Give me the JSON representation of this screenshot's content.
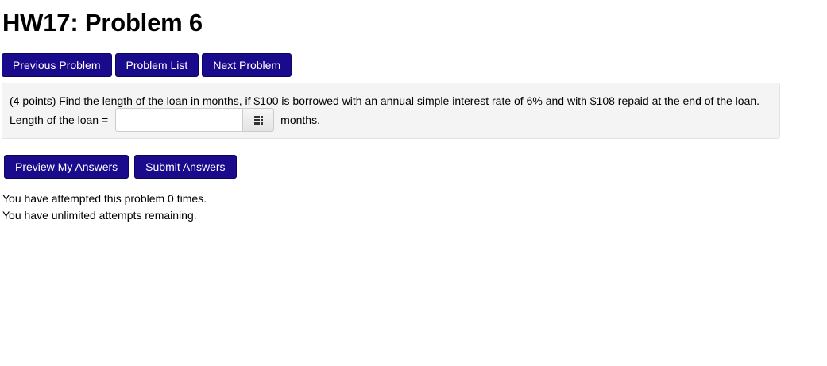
{
  "page": {
    "title": "HW17: Problem 6"
  },
  "nav": {
    "previous_label": "Previous Problem",
    "list_label": "Problem List",
    "next_label": "Next Problem"
  },
  "problem": {
    "text": "(4 points) Find the length of the loan in months, if $100 is borrowed with an annual simple interest rate of 6% and with $108 repaid at the end of the loan.",
    "answer_label": "Length of the loan =",
    "answer_value": "",
    "answer_placeholder": "",
    "answer_suffix": "months.",
    "palette_icon": "grid-icon"
  },
  "actions": {
    "preview_label": "Preview My Answers",
    "submit_label": "Submit Answers"
  },
  "status": {
    "attempts_line": "You have attempted this problem 0 times.",
    "remaining_line": "You have unlimited attempts remaining."
  },
  "colors": {
    "button_bg": "#1a0a8c",
    "button_text": "#ffffff",
    "problem_box_bg": "#f4f4f4"
  }
}
